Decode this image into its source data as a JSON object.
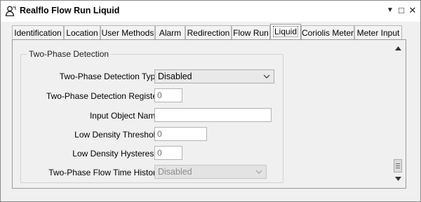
{
  "window": {
    "title": "Realflo Flow Run Liquid",
    "icons": [
      "app-person-icon",
      "dropdown-arrow-icon",
      "maximize-icon",
      "close-icon"
    ],
    "controls": {
      "menu": "▼",
      "maximize": "□",
      "close": "✕"
    }
  },
  "tabs": [
    {
      "label": "Identification"
    },
    {
      "label": "Location"
    },
    {
      "label": "User Methods"
    },
    {
      "label": "Alarm"
    },
    {
      "label": "Redirection"
    },
    {
      "label": "Flow Run"
    },
    {
      "label": "Liquid"
    },
    {
      "label": "Coriolis Meter"
    },
    {
      "label": "Meter Input"
    }
  ],
  "active_tab": "Liquid",
  "group": {
    "title": "Two-Phase Detection",
    "fields": {
      "detection_type": {
        "label": "Two-Phase Detection Type",
        "value": "Disabled"
      },
      "detection_register": {
        "label": "Two-Phase Detection Register",
        "value": "0"
      },
      "input_object_name": {
        "label": "Input Object Name",
        "value": ""
      },
      "low_density_threshold": {
        "label": "Low Density Threshold",
        "value": "0"
      },
      "low_density_hysteresis": {
        "label": "Low Density Hysteresis",
        "value": "0"
      },
      "flow_time_history": {
        "label": "Two-Phase Flow Time History",
        "value": "Disabled"
      }
    }
  },
  "colors": {
    "active_tab_bg": "#ffffff",
    "panel_bg": "#f0f0f0",
    "disabled_text": "#8c8c8c"
  }
}
